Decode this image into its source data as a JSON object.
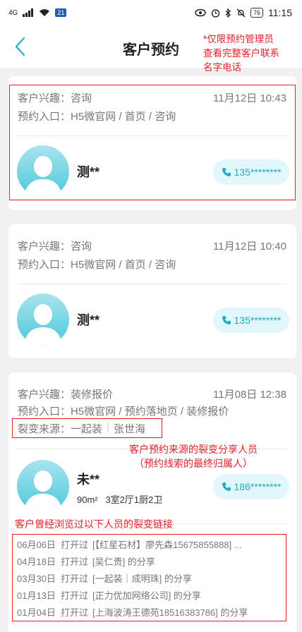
{
  "status_bar": {
    "network": "4G",
    "badge": "21",
    "battery": "76",
    "time": "11:15"
  },
  "header": {
    "title": "客户预约"
  },
  "annotations": {
    "admin_note": [
      "*仅限预约管理员",
      "查看完整客户联系",
      "名字电话"
    ],
    "source_note": [
      "客户预约来源的裂变分享人员",
      "（预约线索的最终归属人）"
    ],
    "trail_note": "客户曾经浏览过以下人员的裂变链接"
  },
  "cards": [
    {
      "interest_label": "客户兴趣：",
      "interest": "咨询",
      "datetime": "11月12日 10:43",
      "entry_label": "预约入口：",
      "entry": "H5微官网 / 首页 / 咨询",
      "name": "测**",
      "phone": "135********"
    },
    {
      "interest_label": "客户兴趣：",
      "interest": "咨询",
      "datetime": "11月12日 10:40",
      "entry_label": "预约入口：",
      "entry": "H5微官网 / 首页 / 咨询",
      "name": "测**",
      "phone": "135********"
    },
    {
      "interest_label": "客户兴趣：",
      "interest": "装修报价",
      "datetime": "11月08日 12:38",
      "entry_label": "预约入口：",
      "entry": "H5微官网 / 预约落地页 / 装修报价",
      "source_label": "裂变来源：",
      "source_company": "一起装",
      "source_person": "张世海",
      "name": "未**",
      "details": "90m²   3室2厅1厨2卫",
      "phone": "186********",
      "trail": [
        {
          "date": "06月06日",
          "action": "打开过",
          "text": "[【红星石材】廖先森15675855888] ..."
        },
        {
          "date": "04月18日",
          "action": "打开过",
          "text": "[吴仁贵] 的分享"
        },
        {
          "date": "03月30日",
          "action": "打开过",
          "text": "[一起装｜成明珠] 的分享"
        },
        {
          "date": "01月13日",
          "action": "打开过",
          "text": "[正力优加网络公司] 的分享"
        },
        {
          "date": "01月04日",
          "action": "打开过",
          "text": "[上海波涛王德苑18516383786] 的分享"
        }
      ]
    }
  ]
}
